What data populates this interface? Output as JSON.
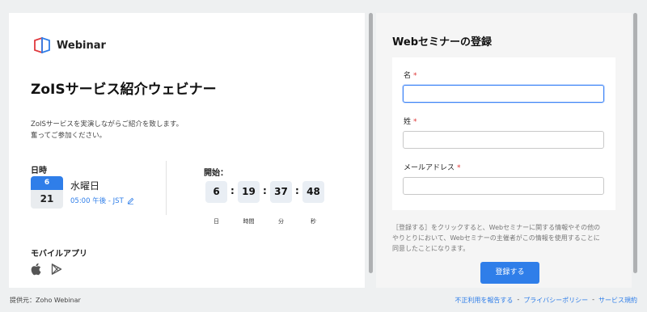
{
  "brand": {
    "name": "Webinar"
  },
  "event": {
    "title": "ZoISサービス紹介ウェビナー",
    "description_lines": [
      "ZoISサービスを実演しながらご紹介を致します。",
      "奮ってご参加ください。"
    ],
    "datetime_label": "日時",
    "calendar": {
      "month": "6",
      "day": "21"
    },
    "weekday": "水曜日",
    "time": "05:00 午後 - JST",
    "start_label": "開始：",
    "countdown": [
      {
        "value": "6",
        "unit": "日"
      },
      {
        "value": "19",
        "unit": "時間"
      },
      {
        "value": "37",
        "unit": "分"
      },
      {
        "value": "48",
        "unit": "秒"
      }
    ],
    "countdown_separator": ":",
    "mobile_label": "モバイルアプリ"
  },
  "form": {
    "title": "Webセミナーの登録",
    "fields": [
      {
        "label": "名",
        "required": "*",
        "value": ""
      },
      {
        "label": "姓",
        "required": "*",
        "value": ""
      },
      {
        "label": "メールアドレス",
        "required": "*",
        "value": ""
      }
    ],
    "notice_lines": [
      "［登録する］をクリックすると、Webセミナーに関する情報やその他の",
      "やりとりにおいて、Webセミナーの主催者がこの情報を使用することに",
      "同意したことになります。"
    ],
    "submit_label": "登録する"
  },
  "footer": {
    "provider": "提供元：Zoho Webinar",
    "links": [
      "不正利用を報告する",
      "プライバシーポリシー",
      "サービス規約"
    ],
    "separator": "-"
  },
  "colors": {
    "accent": "#2f7ee9",
    "required": "#dd3333",
    "background": "#eef0f1"
  }
}
